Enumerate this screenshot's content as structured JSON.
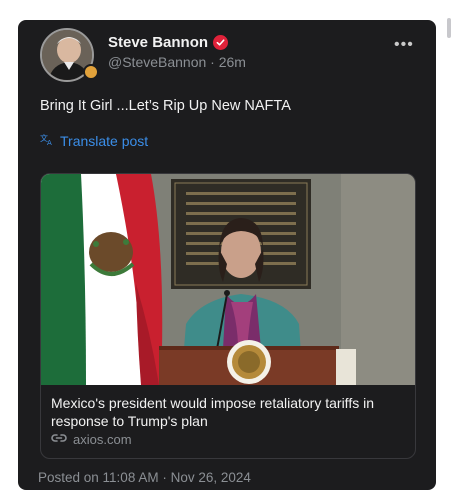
{
  "post": {
    "author_name": "Steve Bannon",
    "handle": "@SteveBannon",
    "separator": "·",
    "relative_time": "26m",
    "text": "Bring It Girl ...Let’s Rip Up New NAFTA",
    "translate_label": "Translate post",
    "more_label": "•••",
    "posted_on": "Posted on 11:08 AM · Nov 26, 2024"
  },
  "link_card": {
    "headline": "Mexico's president would impose retaliatory tariffs in response to Trump's plan",
    "domain": "axios.com"
  },
  "colors": {
    "card_bg": "#1c1c1e",
    "link_blue": "#3b8ee8",
    "verified_red": "#e0223a",
    "muted_text": "#8b8f94"
  },
  "icons": [
    "verified-icon",
    "more-icon",
    "translate-icon",
    "link-icon",
    "affiliate-badge-icon"
  ]
}
